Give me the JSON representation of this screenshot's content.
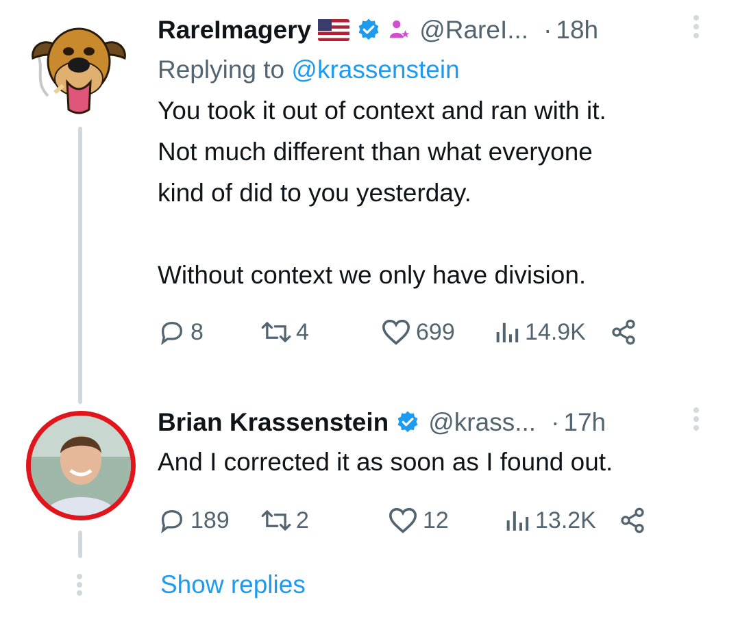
{
  "tweets": [
    {
      "name": "RareImagery",
      "flag_icon": "us-flag-icon",
      "verified_icon": "verified-badge-icon",
      "affiliate_icon": "person-star-icon",
      "handle": "@RareI...",
      "separator": "·",
      "time": "18h",
      "replying_prefix": "Replying to",
      "replying_to": "@krassenstein",
      "body_lines": [
        "You took it out of context and ran with it.",
        "Not much different than what everyone",
        "kind of did to you yesterday.",
        "",
        "Without context we only have division."
      ],
      "replies": "8",
      "retweets": "4",
      "likes": "699",
      "views": "14.9K"
    },
    {
      "name": "Brian Krassenstein",
      "verified_icon": "verified-badge-icon",
      "handle": "@krass...",
      "separator": "·",
      "time": "17h",
      "body_lines": [
        "And I corrected it as soon as I found out."
      ],
      "replies": "189",
      "retweets": "2",
      "likes": "12",
      "views": "13.2K"
    }
  ],
  "show_replies": "Show replies",
  "colors": {
    "text": "#0f1419",
    "secondary": "#536471",
    "accent": "#1d9bf0",
    "thread_line": "#cfd9de",
    "avatar_ring": "#e0161c"
  }
}
